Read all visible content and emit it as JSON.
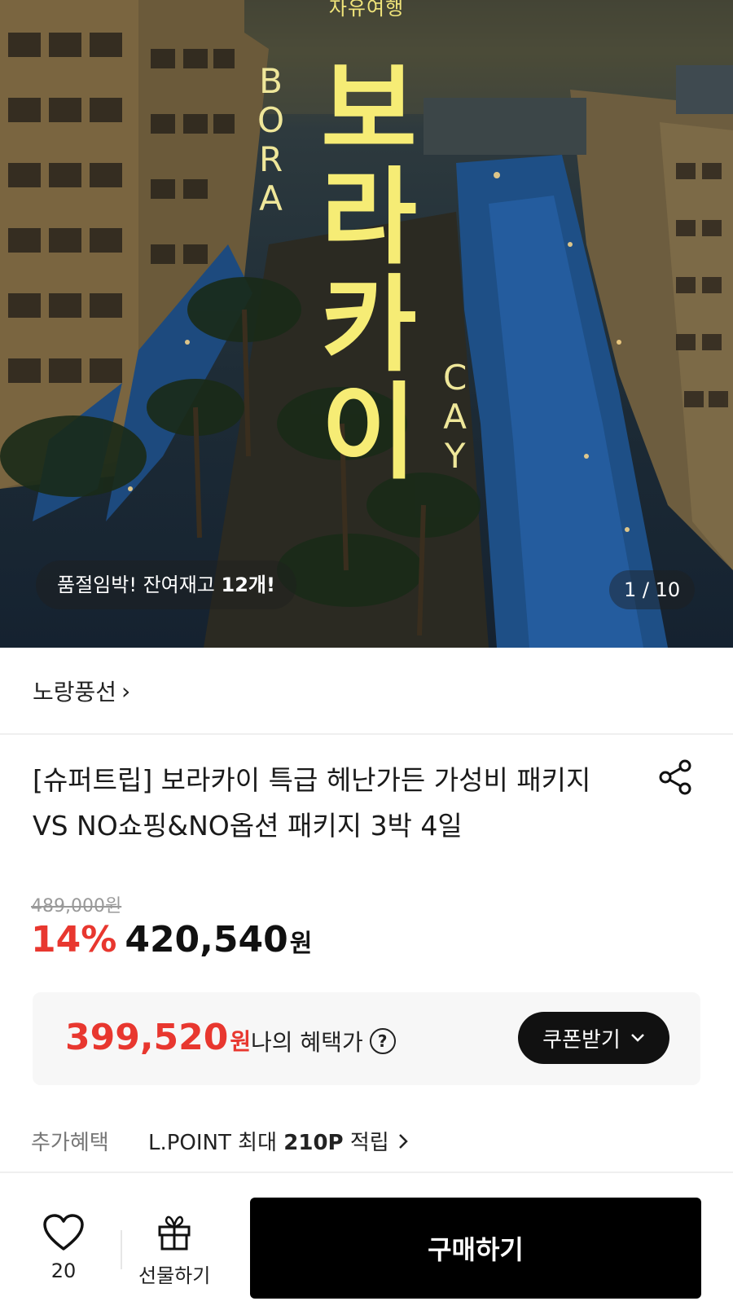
{
  "hero": {
    "top_caption": "자유여행",
    "title_chars": [
      "보",
      "라",
      "카",
      "이"
    ],
    "latin_left": [
      "B",
      "O",
      "R",
      "A"
    ],
    "latin_right": [
      "C",
      "A",
      "Y"
    ],
    "stock_prefix": "품절임박! 잔여재고 ",
    "stock_count": "12개!",
    "page_counter": "1 / 10"
  },
  "brand": {
    "name": "노랑풍선",
    "chevron": "›"
  },
  "product": {
    "title": "[슈퍼트립] 보라카이 특급 헤난가든 가성비 패키지 VS NO쇼핑&NO옵션 패키지 3박 4일"
  },
  "price": {
    "original": "489,000원",
    "discount": "14%",
    "sale": "420,540",
    "sale_unit": "원"
  },
  "benefit": {
    "price": "399,520",
    "unit": "원",
    "label": "나의 혜택가",
    "help": "?",
    "coupon_button": "쿠폰받기"
  },
  "extra": {
    "label": "추가혜택",
    "value_prefix": "L.POINT 최대 ",
    "value_bold": "210P",
    "value_suffix": " 적립"
  },
  "bottom": {
    "like_count": "20",
    "gift_label": "선물하기",
    "buy_label": "구매하기"
  },
  "colors": {
    "accent_red": "#e8372f",
    "title_yellow": "#f6ec75",
    "black": "#000000"
  }
}
